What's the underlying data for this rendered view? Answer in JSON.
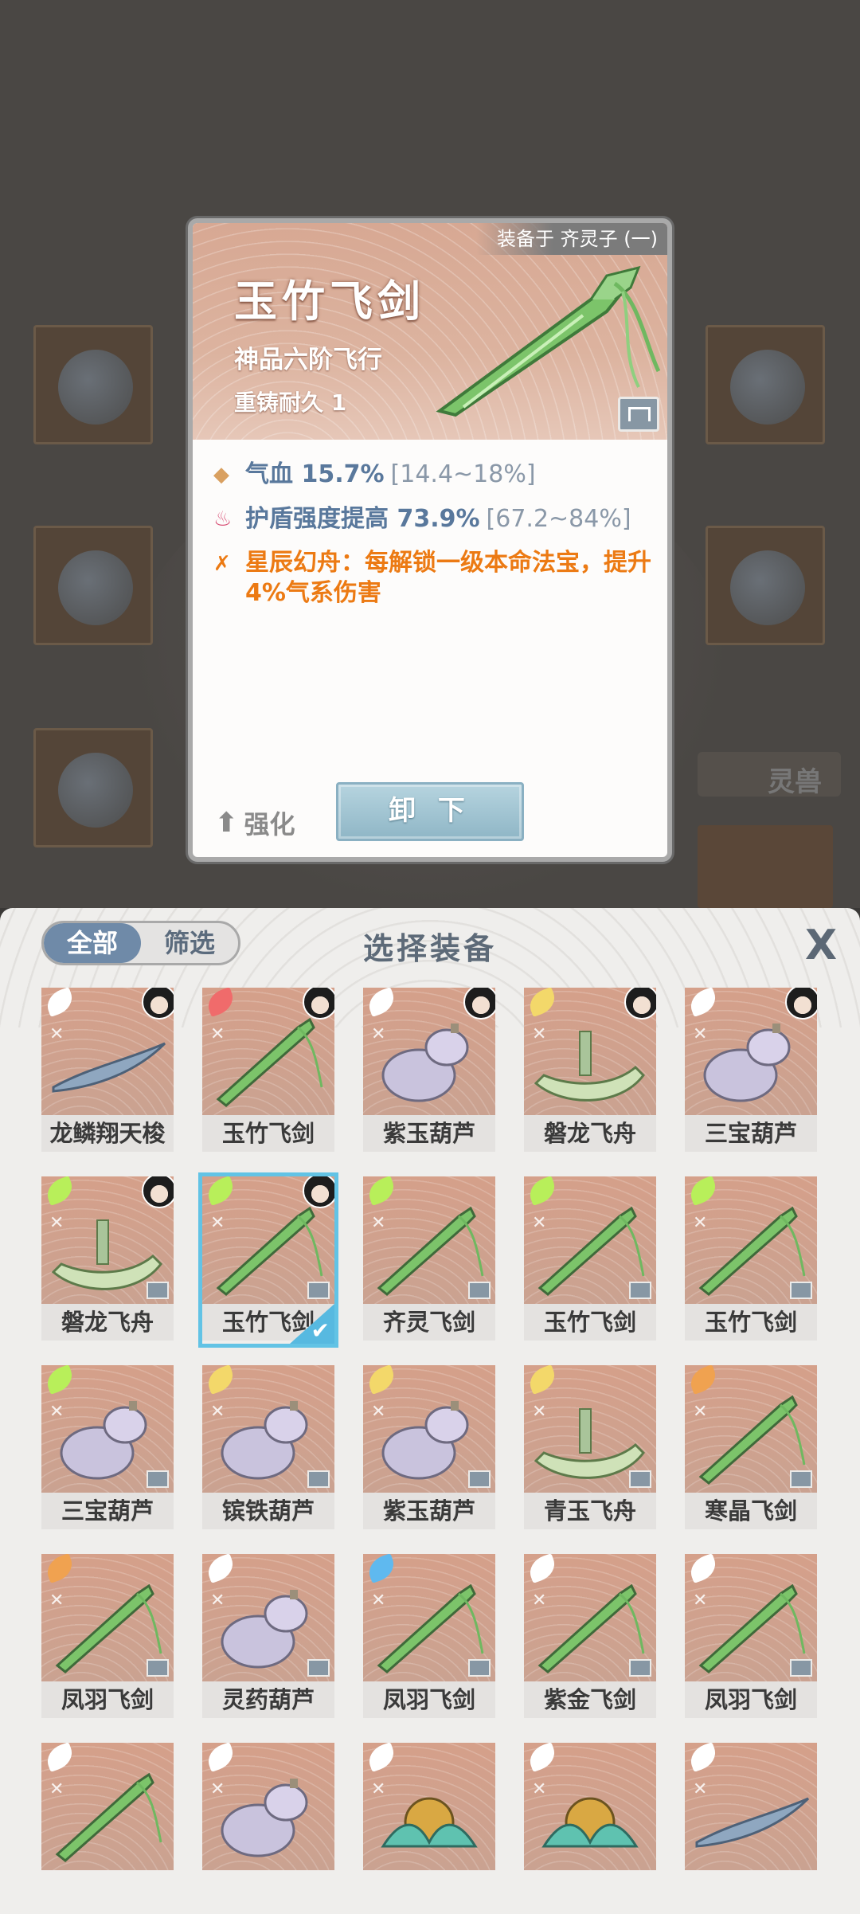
{
  "background": {
    "pet_label": "灵兽"
  },
  "detail": {
    "equipped_on": "装备于 齐灵子 (一)",
    "name": "玉竹飞剑",
    "grade": "神品六阶飞行",
    "recast": "重铸耐久 1",
    "stats": [
      {
        "label": "气血 15.7%",
        "range": "[14.4~18%]",
        "icon": "diamond-icon"
      },
      {
        "label": "护盾强度提高 73.9%",
        "range": "[67.2~84%]",
        "icon": "flame-icon"
      }
    ],
    "special": "星辰幻舟：每解锁一级本命法宝，提升4%气系伤害",
    "enhance_label": "强化",
    "unequip_label": "卸 下",
    "colors": {
      "stat": "#59789c",
      "special": "#ec7a13",
      "selected": "#62c3e5"
    }
  },
  "panel": {
    "tab_all": "全部",
    "tab_filter": "筛选",
    "title": "选择装备",
    "close": "X"
  },
  "items": [
    {
      "name": "龙鳞翔天梭",
      "wing": "white",
      "avatar": true,
      "lock": false,
      "selected": false,
      "art": "shuttle-icon"
    },
    {
      "name": "玉竹飞剑",
      "wing": "red",
      "avatar": true,
      "lock": false,
      "selected": false,
      "art": "sword-icon"
    },
    {
      "name": "紫玉葫芦",
      "wing": "white",
      "avatar": true,
      "lock": false,
      "selected": false,
      "art": "gourd-icon"
    },
    {
      "name": "磐龙飞舟",
      "wing": "yellow",
      "avatar": true,
      "lock": false,
      "selected": false,
      "art": "boat-icon"
    },
    {
      "name": "三宝葫芦",
      "wing": "white",
      "avatar": true,
      "lock": false,
      "selected": false,
      "art": "gourd-icon"
    },
    {
      "name": "磐龙飞舟",
      "wing": "green",
      "avatar": true,
      "lock": true,
      "selected": false,
      "art": "boat-icon"
    },
    {
      "name": "玉竹飞剑",
      "wing": "green",
      "avatar": true,
      "lock": true,
      "selected": true,
      "art": "sword-icon"
    },
    {
      "name": "齐灵飞剑",
      "wing": "green",
      "avatar": false,
      "lock": true,
      "selected": false,
      "art": "sword-icon"
    },
    {
      "name": "玉竹飞剑",
      "wing": "green",
      "avatar": false,
      "lock": true,
      "selected": false,
      "art": "sword-icon"
    },
    {
      "name": "玉竹飞剑",
      "wing": "green",
      "avatar": false,
      "lock": true,
      "selected": false,
      "art": "sword-icon"
    },
    {
      "name": "三宝葫芦",
      "wing": "green",
      "avatar": false,
      "lock": true,
      "selected": false,
      "art": "gourd-icon"
    },
    {
      "name": "镔铁葫芦",
      "wing": "yellow",
      "avatar": false,
      "lock": true,
      "selected": false,
      "art": "gourd-icon"
    },
    {
      "name": "紫玉葫芦",
      "wing": "yellow",
      "avatar": false,
      "lock": true,
      "selected": false,
      "art": "gourd-icon"
    },
    {
      "name": "青玉飞舟",
      "wing": "yellow",
      "avatar": false,
      "lock": true,
      "selected": false,
      "art": "boat-icon"
    },
    {
      "name": "寒晶飞剑",
      "wing": "orange",
      "avatar": false,
      "lock": true,
      "selected": false,
      "art": "sword-icon"
    },
    {
      "name": "凤羽飞剑",
      "wing": "orange",
      "avatar": false,
      "lock": true,
      "selected": false,
      "art": "sword-icon"
    },
    {
      "name": "灵药葫芦",
      "wing": "white",
      "avatar": false,
      "lock": true,
      "selected": false,
      "art": "gourd-icon"
    },
    {
      "name": "凤羽飞剑",
      "wing": "blue",
      "avatar": false,
      "lock": true,
      "selected": false,
      "art": "sword-icon"
    },
    {
      "name": "紫金飞剑",
      "wing": "white",
      "avatar": false,
      "lock": true,
      "selected": false,
      "art": "sword-icon"
    },
    {
      "name": "凤羽飞剑",
      "wing": "white",
      "avatar": false,
      "lock": true,
      "selected": false,
      "art": "sword-icon"
    },
    {
      "name": "",
      "wing": "white",
      "avatar": false,
      "lock": false,
      "selected": false,
      "art": "sword-icon"
    },
    {
      "name": "",
      "wing": "white",
      "avatar": false,
      "lock": false,
      "selected": false,
      "art": "gourd-icon"
    },
    {
      "name": "",
      "wing": "white",
      "avatar": false,
      "lock": false,
      "selected": false,
      "art": "lotus-icon"
    },
    {
      "name": "",
      "wing": "white",
      "avatar": false,
      "lock": false,
      "selected": false,
      "art": "lotus-icon"
    },
    {
      "name": "",
      "wing": "white",
      "avatar": false,
      "lock": false,
      "selected": false,
      "art": "shuttle-icon"
    }
  ]
}
